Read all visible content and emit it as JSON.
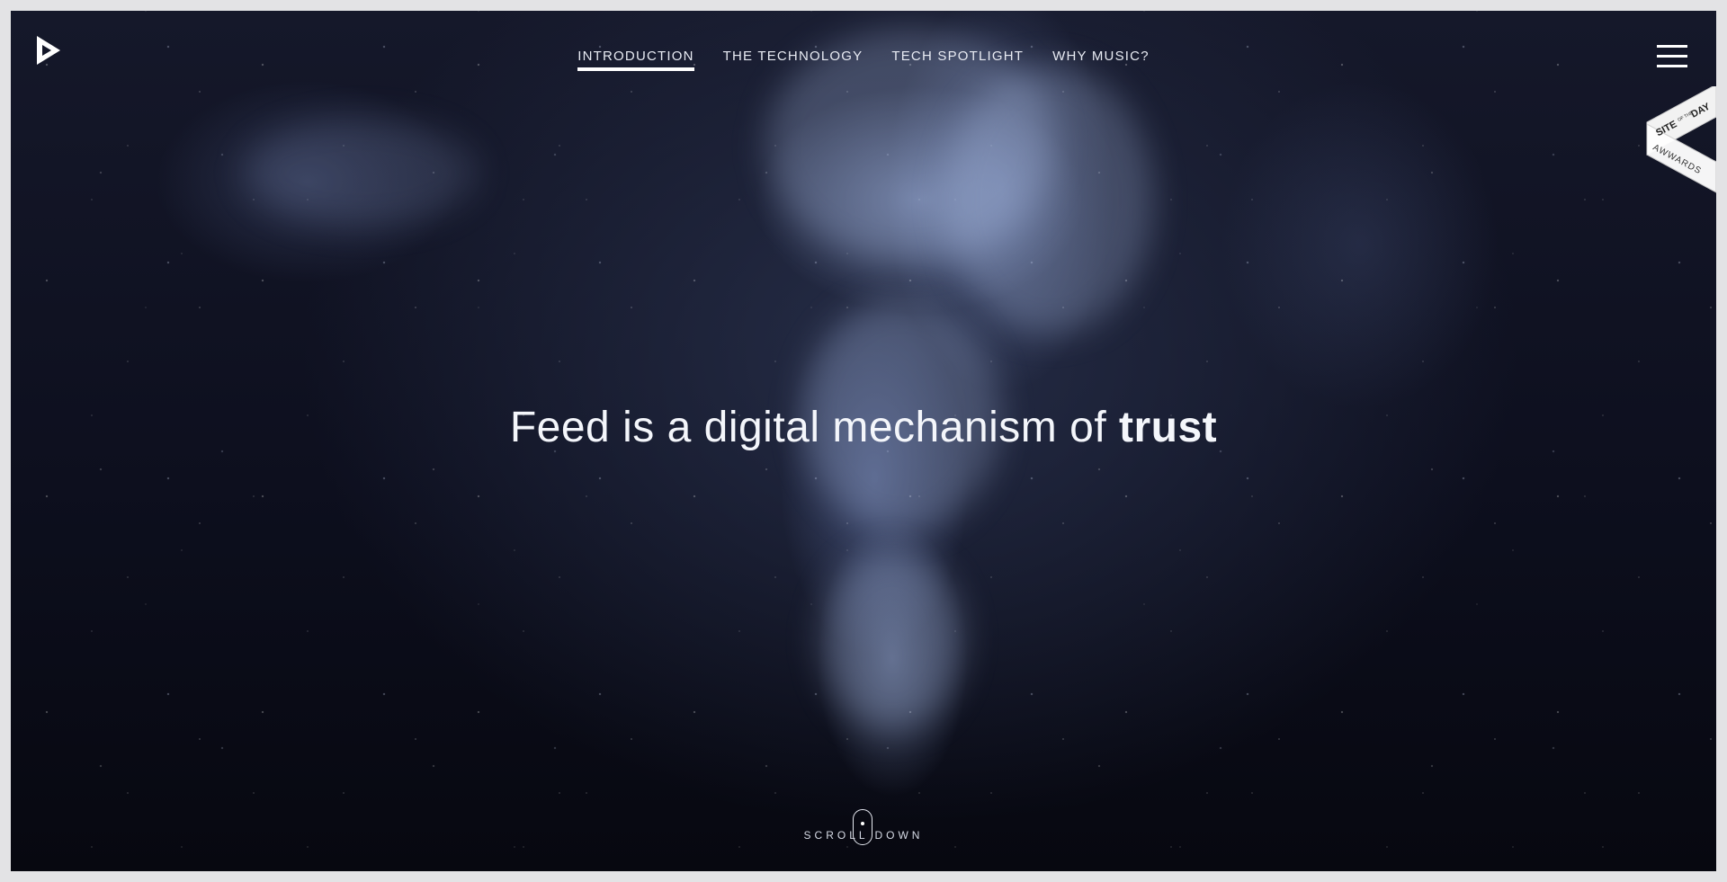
{
  "brand": {
    "logo_icon": "play-triangle-icon"
  },
  "nav": {
    "items": [
      {
        "label": "INTRODUCTION",
        "active": true
      },
      {
        "label": "THE TECHNOLOGY",
        "active": false
      },
      {
        "label": "TECH SPOTLIGHT",
        "active": false
      },
      {
        "label": "WHY MUSIC?",
        "active": false
      }
    ]
  },
  "menu": {
    "icon": "hamburger-menu-icon"
  },
  "hero": {
    "headline_prefix": "Feed is a digital mechanism of ",
    "headline_emphasis": "trust"
  },
  "scroll": {
    "label": "SCROLL DOWN",
    "icon": "mouse-icon"
  },
  "award": {
    "line1": "SITE",
    "line1_small": "OF THE",
    "line2": "DAY",
    "brand": "AWWARDS"
  },
  "colors": {
    "background": "#0d0f1e",
    "frame": "#e3e3e5",
    "text": "#ffffff",
    "award_accent": "#3aa58b"
  }
}
